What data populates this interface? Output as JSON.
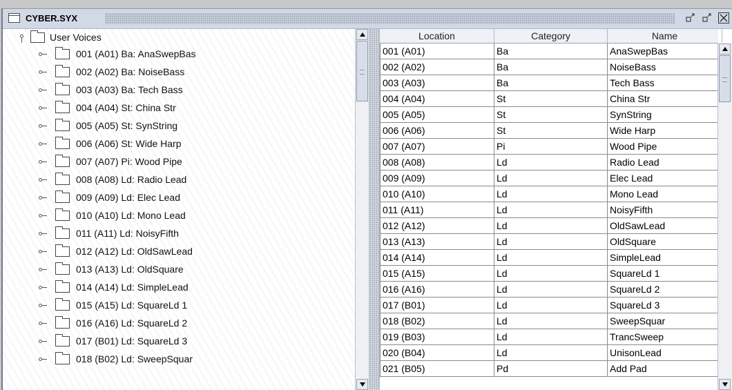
{
  "window": {
    "title": "CYBER.SYX"
  },
  "titlebar_buttons": {
    "minimize": "▫",
    "maximize": "▫",
    "close": "✕"
  },
  "tree": {
    "root_label": "User Voices",
    "items": [
      "001 (A01)  Ba: AnaSwepBas",
      "002 (A02)  Ba: NoiseBass",
      "003 (A03)  Ba: Tech Bass",
      "004 (A04)  St: China Str",
      "005 (A05)  St: SynString",
      "006 (A06)  St: Wide Harp",
      "007 (A07)  Pi: Wood Pipe",
      "008 (A08)  Ld: Radio Lead",
      "009 (A09)  Ld: Elec Lead",
      "010 (A10)  Ld: Mono Lead",
      "011 (A11)  Ld: NoisyFifth",
      "012 (A12)  Ld: OldSawLead",
      "013 (A13)  Ld: OldSquare",
      "014 (A14)  Ld: SimpleLead",
      "015 (A15)  Ld: SquareLd 1",
      "016 (A16)  Ld: SquareLd 2",
      "017 (B01)  Ld: SquareLd 3",
      "018 (B02)  Ld: SweepSquar"
    ]
  },
  "table": {
    "headers": {
      "location": "Location",
      "category": "Category",
      "name": "Name"
    },
    "rows": [
      {
        "location": "001 (A01)",
        "category": "Ba",
        "name": "AnaSwepBas"
      },
      {
        "location": "002 (A02)",
        "category": "Ba",
        "name": "NoiseBass"
      },
      {
        "location": "003 (A03)",
        "category": "Ba",
        "name": "Tech Bass"
      },
      {
        "location": "004 (A04)",
        "category": "St",
        "name": "China Str"
      },
      {
        "location": "005 (A05)",
        "category": "St",
        "name": "SynString"
      },
      {
        "location": "006 (A06)",
        "category": "St",
        "name": "Wide Harp"
      },
      {
        "location": "007 (A07)",
        "category": "Pi",
        "name": "Wood Pipe"
      },
      {
        "location": "008 (A08)",
        "category": "Ld",
        "name": "Radio Lead"
      },
      {
        "location": "009 (A09)",
        "category": "Ld",
        "name": "Elec Lead"
      },
      {
        "location": "010 (A10)",
        "category": "Ld",
        "name": "Mono Lead"
      },
      {
        "location": "011 (A11)",
        "category": "Ld",
        "name": "NoisyFifth"
      },
      {
        "location": "012 (A12)",
        "category": "Ld",
        "name": "OldSawLead"
      },
      {
        "location": "013 (A13)",
        "category": "Ld",
        "name": "OldSquare"
      },
      {
        "location": "014 (A14)",
        "category": "Ld",
        "name": "SimpleLead"
      },
      {
        "location": "015 (A15)",
        "category": "Ld",
        "name": "SquareLd 1"
      },
      {
        "location": "016 (A16)",
        "category": "Ld",
        "name": "SquareLd 2"
      },
      {
        "location": "017 (B01)",
        "category": "Ld",
        "name": "SquareLd 3"
      },
      {
        "location": "018 (B02)",
        "category": "Ld",
        "name": "SweepSquar"
      },
      {
        "location": "019 (B03)",
        "category": "Ld",
        "name": "TrancSweep"
      },
      {
        "location": "020 (B04)",
        "category": "Ld",
        "name": "UnisonLead"
      },
      {
        "location": "021 (B05)",
        "category": "Pd",
        "name": "Add Pad"
      }
    ]
  },
  "icons": {
    "window": "window-icon",
    "folder": "folder-icon",
    "expand": "tree-expand-handle-icon",
    "scroll_up": "arrow-up-icon",
    "scroll_down": "arrow-down-icon"
  },
  "colors": {
    "titlebar": "#d2d9e6",
    "table_header": "#eef1f6",
    "grid": "#8a8a8a"
  }
}
